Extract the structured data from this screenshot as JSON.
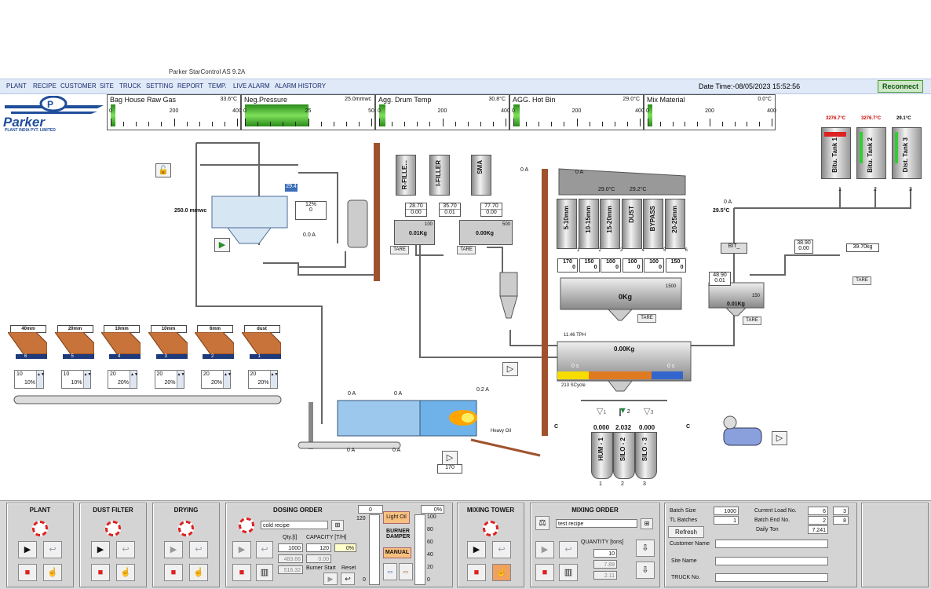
{
  "window_title": "Parker StarControl AS 9.2A",
  "menu": [
    "PLANT",
    "RECIPE",
    "CUSTOMER",
    "SITE",
    "TRUCK",
    "SETTING",
    "REPORT",
    "TEMP.",
    "LIVE ALARM",
    "ALARM HISTORY"
  ],
  "datetime": "Date Time:-08/05/2023 15:52:56",
  "reconnect_label": "Reconnect",
  "logo": {
    "name": "Parker",
    "sub": "PLANT INDIA PVT. LIMITED"
  },
  "gauges": [
    {
      "title": "Bag House Raw Gas",
      "value": "33.6°C",
      "ticks": [
        "0",
        "200",
        "400"
      ],
      "fill": 0.02
    },
    {
      "title": "Neg.Pressure",
      "value": "25.0mmwc",
      "ticks": [
        "0",
        "25",
        "50"
      ],
      "fill": 0.5
    },
    {
      "title": "Agg. Drum Temp",
      "value": "30.8°C",
      "ticks": [
        "0",
        "200",
        "400"
      ],
      "fill": 0.05
    },
    {
      "title": "AGG. Hot Bin",
      "value": "29.0°C",
      "ticks": [
        "0",
        "200",
        "400"
      ],
      "fill": 0.05
    },
    {
      "title": "Mix Material",
      "value": "0.0°C",
      "ticks": [
        "0",
        "200",
        "400"
      ],
      "fill": 0
    }
  ],
  "cold_bins": [
    {
      "label": "40mm",
      "num": "6",
      "a": "10",
      "b": "10%"
    },
    {
      "label": "20mm",
      "num": "5",
      "a": "10",
      "b": "10%"
    },
    {
      "label": "10mm",
      "num": "4",
      "a": "20",
      "b": "20%"
    },
    {
      "label": "10mm",
      "num": "3",
      "a": "20",
      "b": "20%"
    },
    {
      "label": "6mm",
      "num": "2",
      "a": "20",
      "b": "20%"
    },
    {
      "label": "dust",
      "num": "1",
      "a": "20",
      "b": "20%"
    }
  ],
  "filter": {
    "pressure": "250.0 mmwc",
    "temp": "29.4",
    "pct": "12%",
    "pct2": "0",
    "amp": "0.0 A"
  },
  "fillers": [
    {
      "name": "R-FILLE...",
      "v1": "28.70",
      "v2": "0.00"
    },
    {
      "name": "I-FILLER",
      "v1": "35.70",
      "v2": "0.01"
    },
    {
      "name": "SMA",
      "v1": "77.70",
      "v2": "0.00"
    }
  ],
  "weighers": [
    {
      "value": "0.01Kg",
      "cap": "100",
      "tare": "TARE"
    },
    {
      "value": "0.00Kg",
      "cap": "500",
      "tare": "TARE"
    }
  ],
  "hot_bins": {
    "top_amp": "0 A",
    "t1": "29.0°C",
    "t2": "29.2°C",
    "bins": [
      {
        "name": "5-10mm",
        "num": "1",
        "set": "170",
        "act": "0"
      },
      {
        "name": "10-15mm",
        "num": "2",
        "set": "150",
        "act": "0"
      },
      {
        "name": "15-20mm",
        "num": "3",
        "set": "100",
        "act": "0"
      },
      {
        "name": "DUST",
        "num": "4",
        "set": "100",
        "act": "0"
      },
      {
        "name": "BYPASS",
        "num": "5",
        "set": "100",
        "act": "0"
      },
      {
        "name": "20-25mm",
        "num": "6",
        "set": "150",
        "act": "0"
      }
    ],
    "agg_weigh": "0Kg",
    "agg_cap": "1500",
    "tare": "TARE"
  },
  "bitumen": {
    "tanks": [
      {
        "name": "Bitu. Tank 1",
        "temp": "3276.7°C",
        "num": "1"
      },
      {
        "name": "Bitu. Tank 2",
        "temp": "3276.7°C",
        "num": "2"
      },
      {
        "name": "Dist. Tank 3",
        "temp": "29.1°C",
        "num": "3"
      }
    ],
    "amp": "0 A",
    "temp": "29.5°C",
    "bit_label": "BIT_",
    "flow1": "38.90",
    "flow2": "0.00",
    "meter": "39.70kg",
    "tare": "TARE",
    "w1": "48.90",
    "w2": "0.01",
    "weigh": "0.01Kg",
    "cap": "150",
    "tare2": "TARE"
  },
  "mixer": {
    "tph": "11.46 TPH",
    "weight": "0.00Kg",
    "left": "0 s",
    "right": "0 s",
    "cycle": "213 SCycle"
  },
  "discharge": {
    "v1": "1",
    "v2": "2",
    "v3": "3",
    "val1": "0.000",
    "val2": "2.032",
    "val3": "0.000"
  },
  "silos": [
    {
      "name": "HUM - 1",
      "num": "1"
    },
    {
      "name": "SILO - 2",
      "num": "2"
    },
    {
      "name": "SILO - 3",
      "num": "3"
    }
  ],
  "drum": {
    "amp1": "0 A",
    "amp2": "0 A",
    "amp3": "0 A",
    "amp4": "0 A",
    "burner_amp": "0.2 A",
    "fuel": "Heavy Oil",
    "speed": "170"
  },
  "misc": {
    "cyclone_amp": "0 A",
    "c_left": "C",
    "c_right": "C"
  },
  "panels": {
    "plant": "PLANT",
    "dust": "DUST FILTER",
    "drying": "DRYING",
    "dosing": {
      "title": "DOSING ORDER",
      "recipe": "cold recipe",
      "qty_label": "Qty.[t]",
      "cap_label": "CAPACITY [T/H]",
      "qty": "1000",
      "cap": "120",
      "pct": "0%",
      "v1": "483.66",
      "v2": "0.00",
      "v3": "516.32",
      "burner_start": "Burner Start",
      "reset": "Reset",
      "scale_top": "120",
      "scale_zero": "0",
      "gauge_top": "0",
      "gauge_pct": "0%"
    },
    "damper": {
      "light_oil": "Light Oil",
      "burner_damper": "BURNER DAMPER",
      "manual": "MANUAL",
      "scale": [
        "100",
        "80",
        "60",
        "40",
        "20",
        "0"
      ]
    },
    "mixing_tower": "MIXING TOWER",
    "mixing_order": {
      "title": "MIXING ORDER",
      "recipe": "test recipe",
      "qty_label": "QUANTITY [tons]",
      "qty": "10",
      "v1": "7.89",
      "v2": "2.11"
    },
    "batch": {
      "batch_size_label": "Batch Size",
      "batch_size": "1000",
      "tl_label": "TL Batches",
      "tl": "1",
      "refresh": "Refresh",
      "load_label": "Current Load No.",
      "load1": "6",
      "load2": "3",
      "end_label": "Batch End No.",
      "end1": "2",
      "end2": "8",
      "daily_label": "Daily Ton",
      "daily": "7.241",
      "customer": "Customer Name",
      "site": "Site Name",
      "truck": "TRUCK No."
    }
  }
}
